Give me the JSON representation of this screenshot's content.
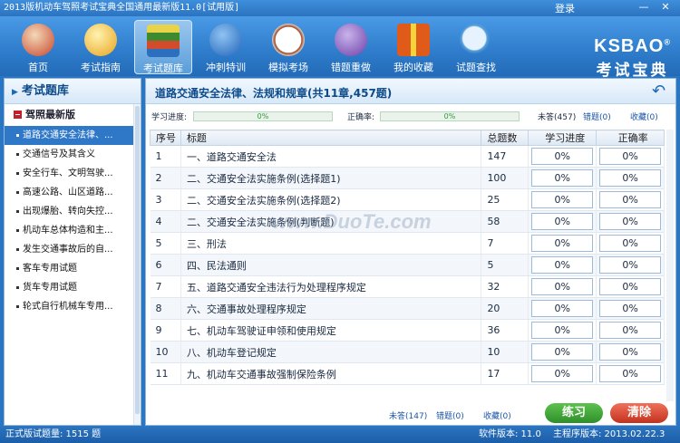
{
  "window": {
    "title": "2013版机动车驾照考试宝典全国通用最新版11.0[试用版]",
    "login": "登录",
    "minimize": "—",
    "close": "✕"
  },
  "toolbar": {
    "items": [
      {
        "label": "首页",
        "icon": "home-icon",
        "color": "#c8442b"
      },
      {
        "label": "考试指南",
        "icon": "compass-icon",
        "color": "#e8a21c"
      },
      {
        "label": "考试题库",
        "icon": "books-icon",
        "color": "#3d8b2e"
      },
      {
        "label": "冲刺特训",
        "icon": "globe-icon",
        "color": "#1f62b8"
      },
      {
        "label": "模拟考场",
        "icon": "clock-icon",
        "color": "#d9d2c3"
      },
      {
        "label": "错题重做",
        "icon": "pen-icon",
        "color": "#6b3fa8"
      },
      {
        "label": "我的收藏",
        "icon": "gift-icon",
        "color": "#e05a1a"
      },
      {
        "label": "试题查找",
        "icon": "magnifier-icon",
        "color": "#5aa0d8"
      }
    ],
    "active_index": 2
  },
  "logo": {
    "en": "KSBAO",
    "reg": "®",
    "cn": "考试宝典"
  },
  "sidebar": {
    "header": "考试题库",
    "group": "驾照最新版",
    "items": [
      "道路交通安全法律、...",
      "交通信号及其含义",
      "安全行车、文明驾驶...",
      "高速公路、山区道路...",
      "出现爆胎、转向失控...",
      "机动车总体构造和主...",
      "发生交通事故后的自...",
      "客车专用试题",
      "货车专用试题",
      "轮式自行机械车专用..."
    ]
  },
  "main": {
    "title": "道路交通安全法律、法规和规章(共11章,457题)",
    "progress_label": "学习进度:",
    "progress_value": "0%",
    "accuracy_label": "正确率:",
    "accuracy_value": "0%",
    "unanswered": "未答(457)",
    "wrong": "错题(0)",
    "favorites": "收藏(0)"
  },
  "table": {
    "headers": [
      "序号",
      "标题",
      "总题数",
      "学习进度",
      "正确率"
    ],
    "rows": [
      [
        "1",
        "一、道路交通安全法",
        "147",
        "0%",
        "0%"
      ],
      [
        "2",
        "二、交通安全法实施条例(选择题1)",
        "100",
        "0%",
        "0%"
      ],
      [
        "3",
        "二、交通安全法实施条例(选择题2)",
        "25",
        "0%",
        "0%"
      ],
      [
        "4",
        "二、交通安全法实施条例(判断题)",
        "58",
        "0%",
        "0%"
      ],
      [
        "5",
        "三、刑法",
        "7",
        "0%",
        "0%"
      ],
      [
        "6",
        "四、民法通则",
        "5",
        "0%",
        "0%"
      ],
      [
        "7",
        "五、道路交通安全违法行为处理程序规定",
        "32",
        "0%",
        "0%"
      ],
      [
        "8",
        "六、交通事故处理程序规定",
        "20",
        "0%",
        "0%"
      ],
      [
        "9",
        "七、机动车驾驶证申领和使用规定",
        "36",
        "0%",
        "0%"
      ],
      [
        "10",
        "八、机动车登记规定",
        "10",
        "0%",
        "0%"
      ],
      [
        "11",
        "九、机动车交通事故强制保险条例",
        "17",
        "0%",
        "0%"
      ]
    ]
  },
  "footer": {
    "unanswered": "未答(147)",
    "wrong": "错题(0)",
    "favorites": "收藏(0)",
    "practice_button": "练习",
    "clear_button": "清除"
  },
  "statusbar": {
    "total": "正式版试题量: 1515 题",
    "software_version": "软件版本: 11.0",
    "main_version": "主程序版本: 2013.02.22.3"
  },
  "watermark": "www.DuoTe.com",
  "colors": {
    "accent": "#2a76c2",
    "practice": "#3aa636",
    "clear": "#d8402c"
  }
}
